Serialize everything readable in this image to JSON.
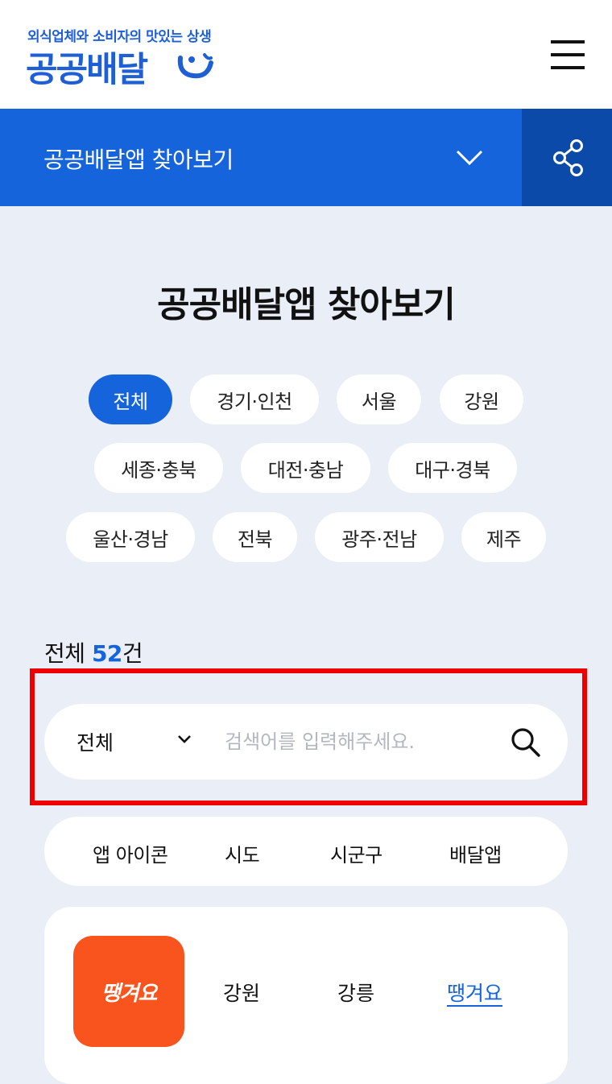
{
  "header": {
    "tagline": "외식업체와 소비자의 맛있는 상생",
    "logo_text": "공공배달",
    "logo_icon": "smile-mark-icon",
    "menu_icon": "hamburger-menu-icon"
  },
  "bluebar": {
    "select_label": "공공배달앱 찾아보기",
    "share_icon": "share-icon"
  },
  "page_title": "공공배달앱 찾아보기",
  "regions": [
    "전체",
    "경기·인천",
    "서울",
    "강원",
    "세종·충북",
    "대전·충남",
    "대구·경북",
    "울산·경남",
    "전북",
    "광주·전남",
    "제주"
  ],
  "selected_region": "전체",
  "count": {
    "prefix": "전체",
    "number": "52",
    "suffix": "건"
  },
  "search": {
    "scope": "전체",
    "placeholder": "검색어를 입력해주세요.",
    "value": ""
  },
  "columns": [
    "앱 아이콘",
    "시도",
    "시군구",
    "배달앱"
  ],
  "results": [
    {
      "icon_text": "땡겨요",
      "sido": "강원",
      "sigungu": "강릉",
      "app": "땡겨요"
    }
  ],
  "colors": {
    "primary": "#1564dc",
    "primary_dark": "#0c4aaa",
    "background": "#e9eef7",
    "app_icon_bg": "#f9541d",
    "highlight": "#ee0000"
  }
}
